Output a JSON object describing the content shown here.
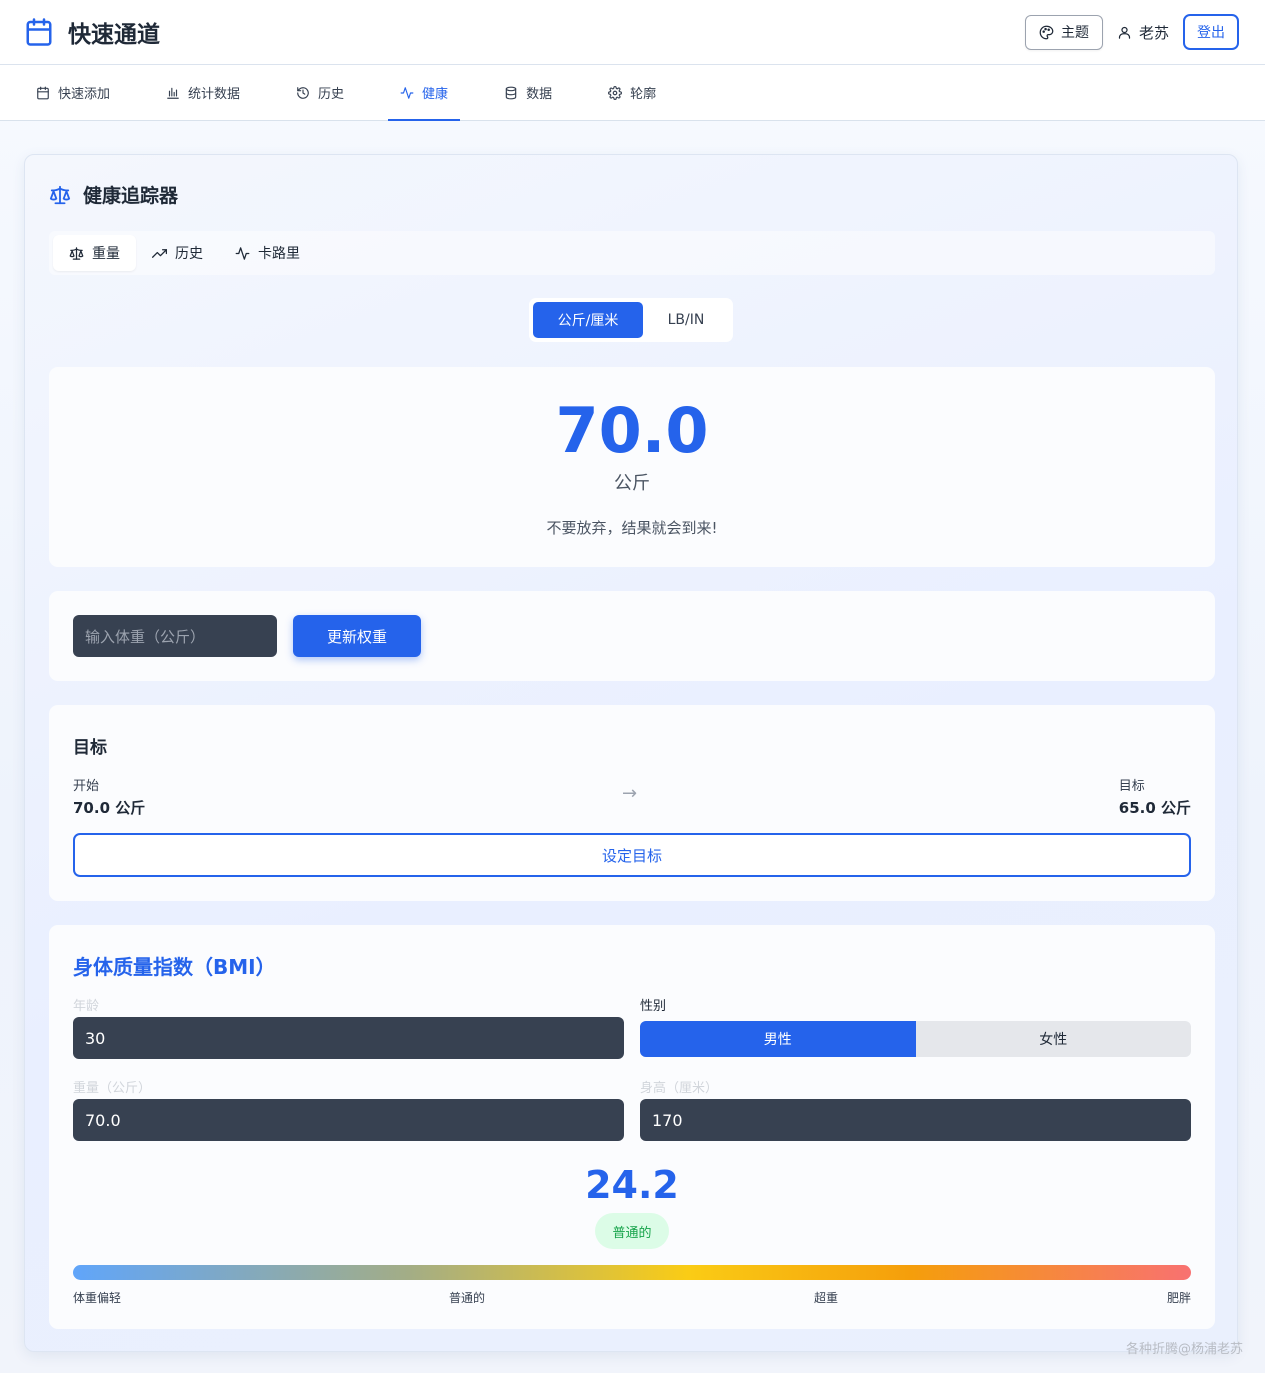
{
  "header": {
    "app_title": "快速通道",
    "theme_label": "主题",
    "user_name": "老苏",
    "logout_label": "登出"
  },
  "nav": {
    "items": [
      {
        "label": "快速添加",
        "icon": "calendar-icon"
      },
      {
        "label": "统计数据",
        "icon": "bar-chart-icon"
      },
      {
        "label": "历史",
        "icon": "history-icon"
      },
      {
        "label": "健康",
        "icon": "activity-icon",
        "active": true
      },
      {
        "label": "数据",
        "icon": "database-icon"
      },
      {
        "label": "轮廓",
        "icon": "gear-icon"
      }
    ]
  },
  "tracker": {
    "title": "健康追踪器",
    "tabs": [
      {
        "label": "重量",
        "icon": "scale-icon",
        "active": true
      },
      {
        "label": "历史",
        "icon": "trending-up-icon"
      },
      {
        "label": "卡路里",
        "icon": "activity-icon"
      }
    ],
    "unit_toggle": {
      "metric": "公斤/厘米",
      "imperial": "LB/IN",
      "selected": "公斤/厘米"
    },
    "current_weight": "70.0",
    "current_unit": "公斤",
    "motivation": "不要放弃，结果就会到来!",
    "weight_input_placeholder": "输入体重（公斤）",
    "update_button": "更新权重",
    "goal": {
      "title": "目标",
      "start_label": "开始",
      "start_value": "70.0 公斤",
      "arrow": "→",
      "target_label": "目标",
      "target_value": "65.0 公斤",
      "set_button": "设定目标"
    },
    "bmi": {
      "title": "身体质量指数（BMI）",
      "age_label": "年龄",
      "age_value": "30",
      "gender_label": "性别",
      "gender_male": "男性",
      "gender_female": "女性",
      "gender_selected": "男性",
      "weight_label": "重量（公斤）",
      "weight_value": "70.0",
      "height_label": "身高（厘米）",
      "height_value": "170",
      "value": "24.2",
      "category": "普通的",
      "scale": [
        "体重偏轻",
        "普通的",
        "超重",
        "肥胖"
      ]
    }
  },
  "watermark": "各种折腾@杨浦老苏",
  "colors": {
    "accent": "#2563eb",
    "input_bg": "#374151",
    "badge_bg": "#dcfce7",
    "badge_text": "#16a34a"
  }
}
